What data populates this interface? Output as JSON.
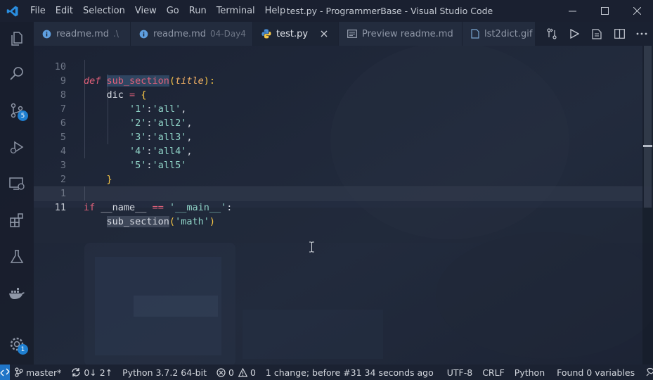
{
  "titlebar": {
    "menus": [
      "File",
      "Edit",
      "Selection",
      "View",
      "Go",
      "Run",
      "Terminal",
      "Help"
    ],
    "window_title": "test.py - ProgrammerBase - Visual Studio Code"
  },
  "activity_bar": {
    "scm_badge": "5",
    "settings_badge": "1"
  },
  "tabs": [
    {
      "label": "readme.md",
      "desc": ".\\",
      "icon": "info-icon"
    },
    {
      "label": "readme.md",
      "desc": "04-Day4",
      "icon": "info-icon"
    },
    {
      "label": "test.py",
      "desc": "",
      "icon": "python-icon",
      "active": true
    },
    {
      "label": "Preview readme.md",
      "desc": "",
      "icon": "preview-icon"
    },
    {
      "label": "lst2dict.gif",
      "desc": "",
      "icon": "image-icon"
    }
  ],
  "editor": {
    "line_numbers": [
      "10",
      "9",
      "8",
      "7",
      "6",
      "5",
      "4",
      "3",
      "2",
      "1",
      "11"
    ],
    "code": {
      "l10_kw": "def",
      "l10_fn": "sub_section",
      "l10_open": "(",
      "l10_param": "title",
      "l10_close": "):",
      "l9_var": "dic",
      "l9_op": "=",
      "l9_brace": "{",
      "dict": [
        {
          "key": "'1'",
          "value": "'all'"
        },
        {
          "key": "'2'",
          "value": "'all2'"
        },
        {
          "key": "'3'",
          "value": "'all3'"
        },
        {
          "key": "'4'",
          "value": "'all4'"
        },
        {
          "key": "'5'",
          "value": "'all5'"
        }
      ],
      "l3_brace": "}",
      "l1_kw": "if",
      "l1_name": "__name__",
      "l1_op": "==",
      "l1_str": "'__main__'",
      "l1_colon": ":",
      "l11_call": "sub_section",
      "l11_open": "(",
      "l11_arg": "'math'",
      "l11_close": ")"
    }
  },
  "statusbar": {
    "branch": "master*",
    "sync": "0↓ 2↑",
    "python": "Python 3.7.2 64-bit",
    "errors": "0",
    "warnings": "0",
    "timeline": "1 change; before #31  34 seconds ago",
    "encoding": "UTF-8",
    "eol": "CRLF",
    "language": "Python",
    "variables": "Found 0 variables"
  }
}
